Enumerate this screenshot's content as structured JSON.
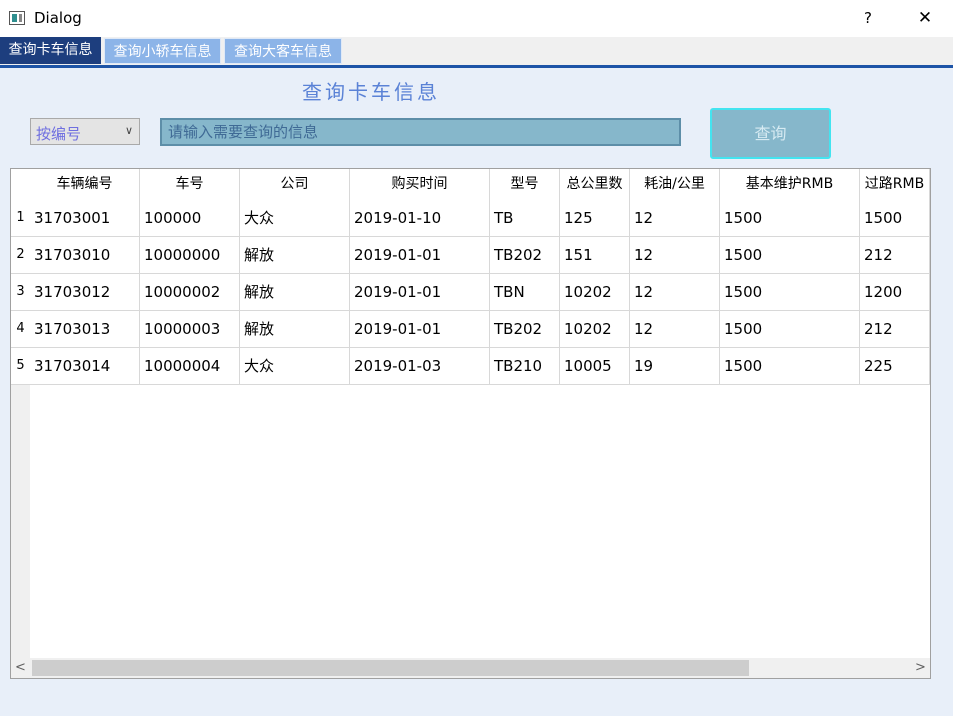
{
  "window": {
    "title": "Dialog",
    "help_label": "?",
    "close_label": "✕"
  },
  "tabs": [
    {
      "label": "查询卡车信息",
      "active": true
    },
    {
      "label": "查询小轿车信息",
      "active": false
    },
    {
      "label": "查询大客车信息",
      "active": false
    }
  ],
  "page": {
    "heading": "查询卡车信息"
  },
  "search": {
    "mode_selected": "按编号",
    "placeholder": "请输入需要查询的信息",
    "button_label": "查询"
  },
  "table": {
    "columns": [
      "车辆编号",
      "车号",
      "公司",
      "购买时间",
      "型号",
      "总公里数",
      "耗油/公里",
      "基本维护RMB",
      "过路RMB"
    ],
    "row_numbers": [
      "1",
      "2",
      "3",
      "4",
      "5"
    ],
    "rows": [
      [
        "31703001",
        "100000",
        "大众",
        "2019-01-10",
        "TB",
        "125",
        "12",
        "1500",
        "1500"
      ],
      [
        "31703010",
        "10000000",
        "解放",
        "2019-01-01",
        "TB202",
        "151",
        "12",
        "1500",
        "212"
      ],
      [
        "31703012",
        "10000002",
        "解放",
        "2019-01-01",
        "TBN",
        "10202",
        "12",
        "1500",
        "1200"
      ],
      [
        "31703013",
        "10000003",
        "解放",
        "2019-01-01",
        "TB202",
        "10202",
        "12",
        "1500",
        "212"
      ],
      [
        "31703014",
        "10000004",
        "大众",
        "2019-01-03",
        "TB210",
        "10005",
        "19",
        "1500",
        "225"
      ]
    ]
  },
  "scrollbar": {
    "left_arrow": "<",
    "right_arrow": ">"
  },
  "colors": {
    "active_tab": "#1d3e7e",
    "inactive_tab": "#8cb4e8",
    "heading": "#5a82d6",
    "search_bg": "#86b7cb",
    "button_border": "#43e4f0"
  },
  "icons": {
    "combo_arrow": "chevron-down-icon",
    "window_icon": "app-icon"
  }
}
